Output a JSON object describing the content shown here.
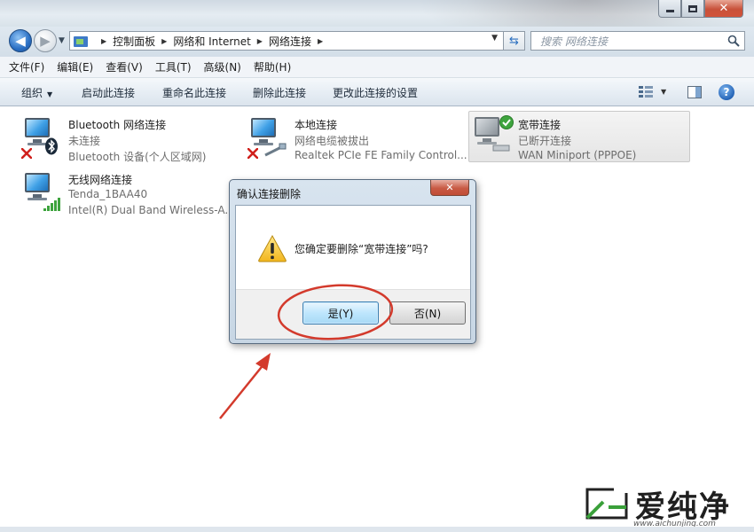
{
  "address": {
    "crumbs": [
      "控制面板",
      "网络和 Internet",
      "网络连接"
    ]
  },
  "search": {
    "placeholder": "搜索 网络连接"
  },
  "menu": [
    "文件(F)",
    "编辑(E)",
    "查看(V)",
    "工具(T)",
    "高级(N)",
    "帮助(H)"
  ],
  "commands": {
    "organize": "组织",
    "enable": "启动此连接",
    "rename": "重命名此连接",
    "delete": "删除此连接",
    "settings": "更改此连接的设置"
  },
  "connections": [
    {
      "name": "Bluetooth 网络连接",
      "status": "未连接",
      "device": "Bluetooth 设备(个人区域网)"
    },
    {
      "name": "本地连接",
      "status": "网络电缆被拔出",
      "device": "Realtek PCIe FE Family Control..."
    },
    {
      "name": "宽带连接",
      "status": "已断开连接",
      "device": "WAN Miniport (PPPOE)"
    },
    {
      "name": "无线网络连接",
      "status": "Tenda_1BAA40",
      "device": "Intel(R) Dual Band Wireless-A..."
    }
  ],
  "dialog": {
    "title": "确认连接删除",
    "message": "您确定要删除“宽带连接”吗?",
    "yes": "是(Y)",
    "no": "否(N)"
  },
  "watermark": {
    "text": "爱纯净",
    "url": "www.aichunjing.com"
  },
  "colors": {
    "annotation": "#d33a2c",
    "accent": "#2a6fc4"
  }
}
